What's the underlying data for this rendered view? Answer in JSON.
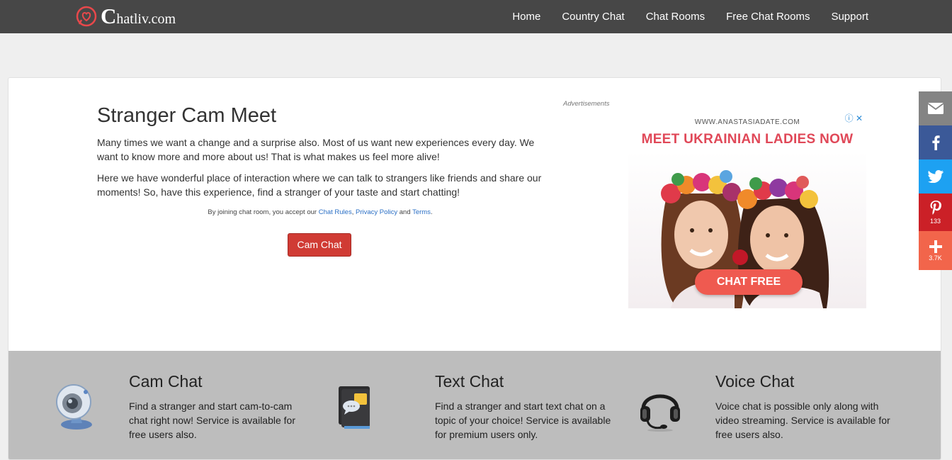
{
  "brand": {
    "first_letter": "C",
    "rest": "hatliv.com"
  },
  "nav": {
    "items": [
      "Home",
      "Country Chat",
      "Chat Rooms",
      "Free Chat Rooms",
      "Support"
    ]
  },
  "intro": {
    "title": "Stranger Cam Meet",
    "para1": "Many times we want a change and a surprise also. Most of us want new experiences every day. We want to know more and more about us! That is what makes us feel more alive!",
    "para2": "Here we have wonderful place of interaction where we can talk to strangers like friends and share our moments! So, have this experience, find a stranger of your taste and start chatting!",
    "terms_prefix": "By joining chat room, you accept our",
    "terms_rules": "Chat Rules",
    "terms_comma": ",",
    "terms_privacy": "Privacy Policy",
    "terms_and": "and",
    "terms_terms": "Terms",
    "terms_period": ".",
    "cta_label": "Cam Chat"
  },
  "ad": {
    "label": "Advertisements",
    "url": "WWW.ANASTASIADATE.COM",
    "headline": "MEET UKRAINIAN LADIES NOW",
    "button": "CHAT FREE",
    "controls": "ⓘ ✕"
  },
  "features": [
    {
      "title": "Cam Chat",
      "text": "Find a stranger and start cam-to-cam chat right now! Service is available for free users also.",
      "icon": "webcam-icon"
    },
    {
      "title": "Text Chat",
      "text": "Find a stranger and start text chat on a topic of your choice! Service is available for premium users only.",
      "icon": "text-chat-icon"
    },
    {
      "title": "Voice Chat",
      "text": "Voice chat is possible only along with video streaming. Service is available for free users also.",
      "icon": "headset-icon"
    }
  ],
  "social": {
    "pinterest_count": "133",
    "more_count": "3.7K"
  },
  "colors": {
    "topbar": "#474747",
    "cta": "#d03b34",
    "band": "#bdbdbd",
    "facebook": "#3b5998",
    "twitter": "#1da1f2",
    "pinterest": "#cb2027",
    "more": "#f2654b"
  }
}
